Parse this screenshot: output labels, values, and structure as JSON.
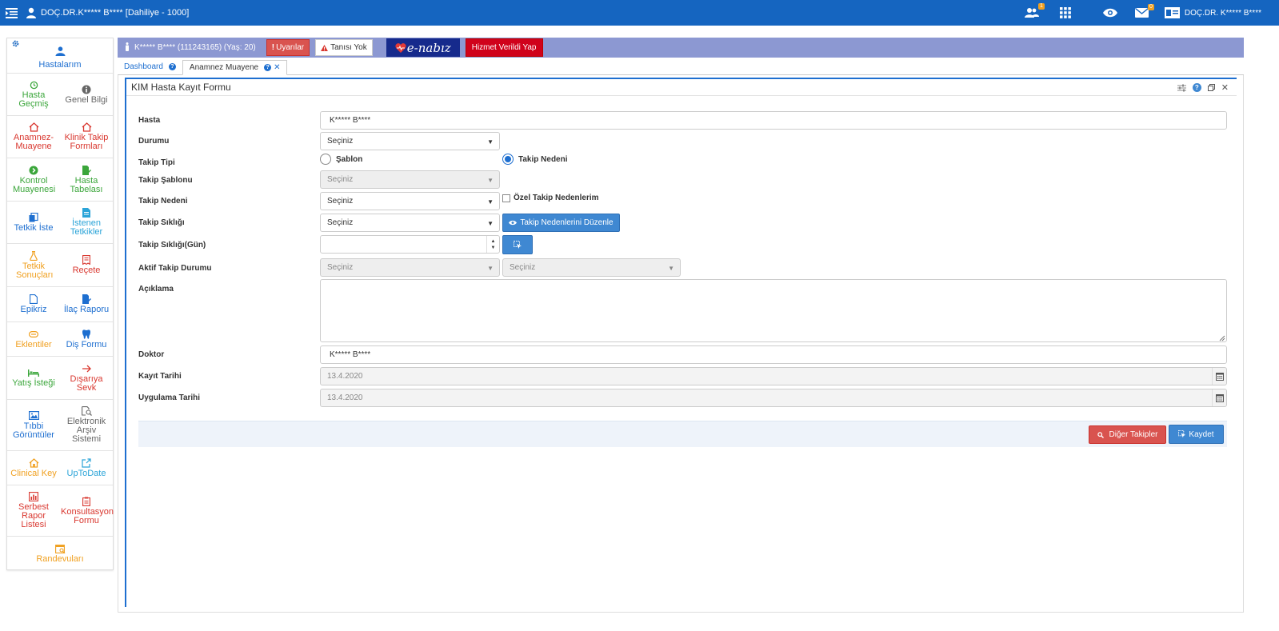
{
  "topbar": {
    "user_title": "DOÇ.DR.K***** B**** [Dahiliye - 1000]",
    "users_badge": "1",
    "mail_badge": "0",
    "doctor_name": "DOÇ.DR. K***** B****",
    "colors": {
      "bar": "#1565c0",
      "badge": "#f0a020"
    }
  },
  "sidebar": {
    "top": {
      "label": "Hastalarım",
      "icon": "user-icon"
    },
    "rows": [
      [
        {
          "label": "Hasta Geçmiş",
          "icon": "history-icon",
          "color": "green"
        },
        {
          "label": "Genel Bilgi",
          "icon": "info-icon",
          "color": "gray"
        }
      ],
      [
        {
          "label": "Anamnez-Muayene",
          "icon": "home-icon",
          "color": "red"
        },
        {
          "label": "Klinik Takip Formları",
          "icon": "home-icon",
          "color": "red"
        }
      ],
      [
        {
          "label": "Kontrol Muayenesi",
          "icon": "arrow-circle-icon",
          "color": "green"
        },
        {
          "label": "Hasta Tabelası",
          "icon": "edit-doc-icon",
          "color": "green"
        }
      ],
      [
        {
          "label": "Tetkik İste",
          "icon": "copy-icon",
          "color": "blue"
        },
        {
          "label": "İstenen Tetkikler",
          "icon": "doc-icon",
          "color": "lblue"
        }
      ],
      [
        {
          "label": "Tetkik Sonuçları",
          "icon": "flask-icon",
          "color": "orange"
        },
        {
          "label": "Reçete",
          "icon": "receipt-icon",
          "color": "red"
        }
      ],
      [
        {
          "label": "Epikriz",
          "icon": "file-icon",
          "color": "blue"
        },
        {
          "label": "İlaç Raporu",
          "icon": "edit-doc-icon",
          "color": "blue"
        }
      ],
      [
        {
          "label": "Eklentiler",
          "icon": "paperclip-icon",
          "color": "orange"
        },
        {
          "label": "Diş Formu",
          "icon": "tooth-icon",
          "color": "blue"
        }
      ],
      [
        {
          "label": "Yatış İsteği",
          "icon": "bed-icon",
          "color": "green"
        },
        {
          "label": "Dışarıya Sevk",
          "icon": "arrow-right-icon",
          "color": "red"
        }
      ],
      [
        {
          "label": "Tıbbi Görüntüler",
          "icon": "image-icon",
          "color": "blue"
        },
        {
          "label": "Elektronik Arşiv Sistemi",
          "icon": "search-doc-icon",
          "color": "gray"
        }
      ],
      [
        {
          "label": "Clinical Key",
          "icon": "home-icon",
          "color": "orange"
        },
        {
          "label": "UpToDate",
          "icon": "external-link-icon",
          "color": "lblue"
        }
      ],
      [
        {
          "label": "Serbest Rapor Listesi",
          "icon": "chart-doc-icon",
          "color": "red"
        },
        {
          "label": "Konsultasyon Formu",
          "icon": "clipboard-icon",
          "color": "red"
        }
      ]
    ],
    "bottom": {
      "label": "Randevuları",
      "icon": "calendar-search-icon"
    }
  },
  "patient": {
    "name": "K***** B**** (111243165) (Yaş: 20)",
    "warnings_label": "Uyarılar",
    "diagnosis_label": "Tanısı Yok",
    "enabiz_label": "e-nabız",
    "service_label": "Hizmet Verildi Yap"
  },
  "tabs": [
    {
      "label": "Dashboard"
    },
    {
      "label": "Anamnez Muayene"
    }
  ],
  "form": {
    "title": "KIM Hasta Kayıt Formu",
    "labels": {
      "hasta": "Hasta",
      "durumu": "Durumu",
      "takip_tipi": "Takip Tipi",
      "takip_sablonu": "Takip Şablonu",
      "takip_nedeni": "Takip Nedeni",
      "takip_sikligi": "Takip Sıklığı",
      "takip_sikligi_gun": "Takip Sıklığı(Gün)",
      "aktif_takip_durumu": "Aktif Takip Durumu",
      "aciklama": "Açıklama",
      "doktor": "Doktor",
      "kayit_tarihi": "Kayıt Tarihi",
      "uygulama_tarihi": "Uygulama Tarihi"
    },
    "values": {
      "hasta": "K***** B****",
      "durumu": "Seçiniz",
      "takip_sablonu": "Seçiniz",
      "takip_nedeni": "Seçiniz",
      "takip_sikligi": "Seçiniz",
      "takip_sikligi_gun": "",
      "aktif_takip_durumu_1": "Seçiniz",
      "aktif_takip_durumu_2": "Seçiniz",
      "aciklama": "",
      "doktor": "K***** B****",
      "kayit_tarihi": "13.4.2020",
      "uygulama_tarihi": "13.4.2020"
    },
    "radio": {
      "sablon": "Şablon",
      "takip_nedeni": "Takip Nedeni",
      "selected": "takip_nedeni"
    },
    "ozel_takip_label": "Özel Takip Nedenlerim",
    "duzenle_label": "Takip Nedenlerini Düzenle",
    "diger_takipler_label": "Diğer Takipler",
    "kaydet_label": "Kaydet",
    "colors": {
      "primary": "#3f88d2",
      "danger": "#d9534f"
    }
  }
}
